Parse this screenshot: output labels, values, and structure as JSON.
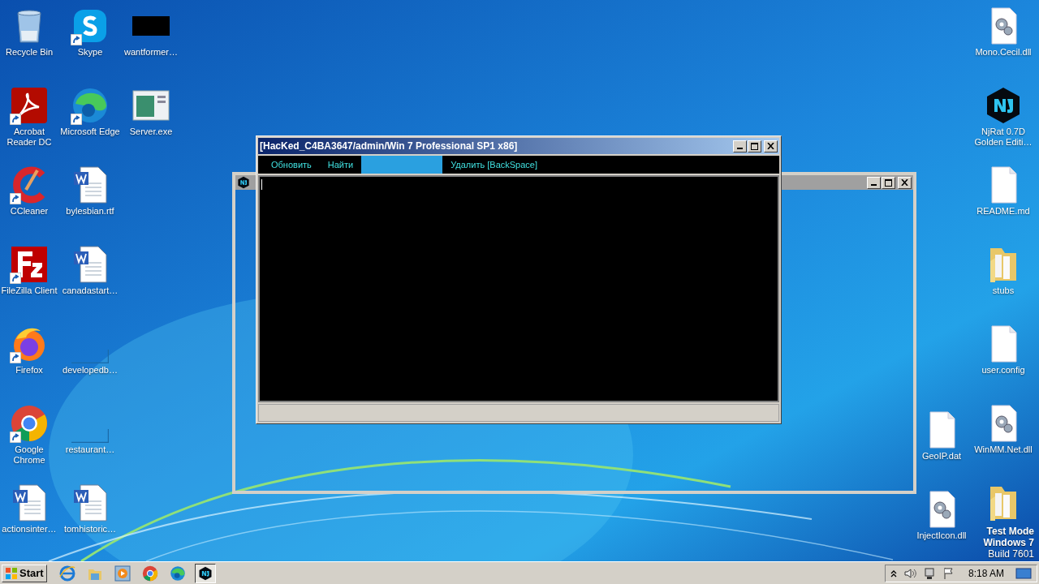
{
  "desktop": {
    "left_columns": [
      [
        {
          "label": "Recycle Bin",
          "kind": "recycle",
          "shortcut": false
        },
        {
          "label": "Acrobat Reader DC",
          "kind": "pdf",
          "shortcut": true
        },
        {
          "label": "CCleaner",
          "kind": "ccleaner",
          "shortcut": true
        },
        {
          "label": "FileZilla Client",
          "kind": "filezilla",
          "shortcut": true
        },
        {
          "label": "Firefox",
          "kind": "firefox",
          "shortcut": true
        },
        {
          "label": "Google Chrome",
          "kind": "chrome",
          "shortcut": true
        },
        {
          "label": "actionsinter…",
          "kind": "word",
          "shortcut": false
        }
      ],
      [
        {
          "label": "Skype",
          "kind": "skype",
          "shortcut": true
        },
        {
          "label": "Microsoft Edge",
          "kind": "edge",
          "shortcut": true
        },
        {
          "label": "bylesbian.rtf",
          "kind": "word",
          "shortcut": false
        },
        {
          "label": "canadastart…",
          "kind": "word",
          "shortcut": false
        },
        {
          "label": "developedb…",
          "kind": "blank",
          "shortcut": false
        },
        {
          "label": "restaurant…",
          "kind": "blank",
          "shortcut": false
        },
        {
          "label": "tomhistoric…",
          "kind": "word",
          "shortcut": false
        }
      ],
      [
        {
          "label": "wantformer…",
          "kind": "black",
          "shortcut": false
        },
        {
          "label": "Server.exe",
          "kind": "exe",
          "shortcut": false
        }
      ]
    ],
    "right_columns": [
      [
        {
          "label": "GeoIP.dat",
          "kind": "file",
          "shortcut": false
        },
        {
          "label": "InjectIcon.dll",
          "kind": "dll",
          "shortcut": false
        }
      ],
      [
        {
          "label": "Mono.Cecil.dll",
          "kind": "dll",
          "shortcut": false
        },
        {
          "label": "NjRat 0.7D Golden Editi…",
          "kind": "nj",
          "shortcut": false
        },
        {
          "label": "README.md",
          "kind": "file",
          "shortcut": false
        },
        {
          "label": "stubs",
          "kind": "folder",
          "shortcut": false
        },
        {
          "label": "user.config",
          "kind": "file",
          "shortcut": false
        },
        {
          "label": "WinMM.Net.dll",
          "kind": "dll",
          "shortcut": false
        },
        {
          "kind": "folder",
          "shortcut": false
        }
      ]
    ],
    "test_mode": [
      "Test Mode",
      "Windows 7",
      "Build 7601"
    ]
  },
  "back_window": {
    "active": false
  },
  "window": {
    "title": "[HacKed_C4BA3647/admin/Win 7 Professional SP1 x86]",
    "active": true,
    "toolbar": [
      {
        "kind": "button",
        "label": "Обновить"
      },
      {
        "kind": "button",
        "label": "Найти"
      },
      {
        "kind": "field"
      },
      {
        "kind": "button",
        "label": "Удалить [BackSpace]"
      }
    ]
  },
  "taskbar": {
    "start": "Start",
    "apps": [
      {
        "kind": "ie",
        "selected": false
      },
      {
        "kind": "explorer",
        "selected": false
      },
      {
        "kind": "media",
        "selected": false
      },
      {
        "kind": "chrome",
        "selected": false
      },
      {
        "kind": "edge",
        "selected": false
      },
      {
        "kind": "nj",
        "selected": true
      }
    ],
    "clock": "8:18 AM"
  }
}
